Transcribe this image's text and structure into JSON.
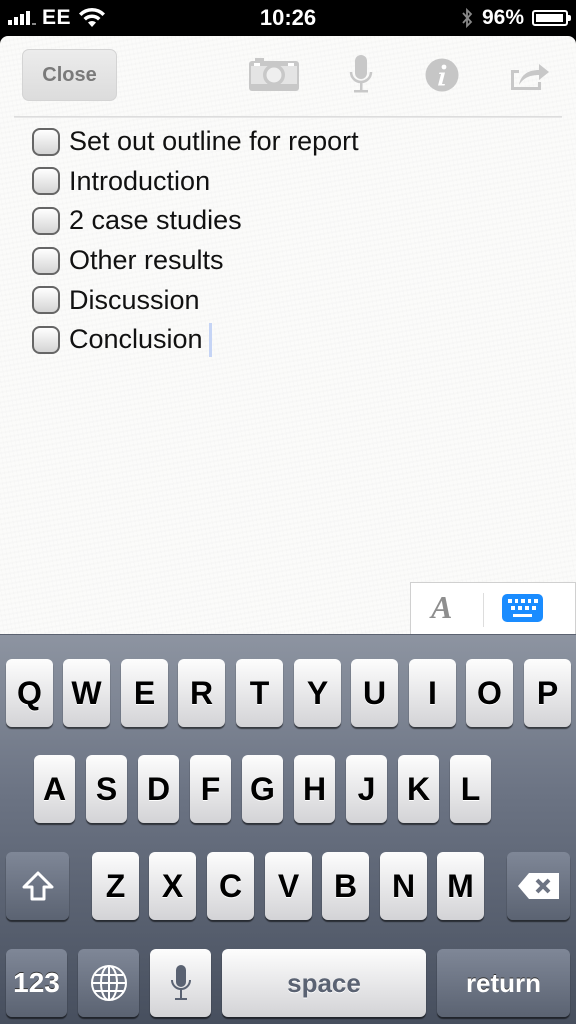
{
  "status_bar": {
    "carrier": "EE",
    "time": "10:26",
    "battery_percent": "96%",
    "battery_level": 0.96,
    "signal_bars": 4,
    "icons": [
      "signal-icon",
      "wifi-icon",
      "bluetooth-icon",
      "battery-icon"
    ]
  },
  "toolbar": {
    "close_label": "Close",
    "icons": [
      "camera-icon",
      "microphone-icon",
      "info-icon",
      "share-icon"
    ]
  },
  "note": {
    "checklist": [
      {
        "text": "Set out outline for report",
        "checked": false
      },
      {
        "text": "Introduction",
        "checked": false
      },
      {
        "text": "2 case studies",
        "checked": false
      },
      {
        "text": "Other results",
        "checked": false
      },
      {
        "text": "Discussion",
        "checked": false
      },
      {
        "text": "Conclusion",
        "checked": false
      }
    ]
  },
  "format_panel": {
    "font_label": "A",
    "icons": [
      "font-format-icon",
      "keyboard-icon"
    ],
    "accent_color": "#1a8cff"
  },
  "keyboard": {
    "row1": [
      "Q",
      "W",
      "E",
      "R",
      "T",
      "Y",
      "U",
      "I",
      "O",
      "P"
    ],
    "row2": [
      "A",
      "S",
      "D",
      "F",
      "G",
      "H",
      "J",
      "K",
      "L"
    ],
    "row3": [
      "Z",
      "X",
      "C",
      "V",
      "B",
      "N",
      "M"
    ],
    "numbers_label": "123",
    "space_label": "space",
    "return_label": "return",
    "icons": [
      "shift-icon",
      "delete-icon",
      "globe-icon",
      "dictation-icon"
    ]
  }
}
